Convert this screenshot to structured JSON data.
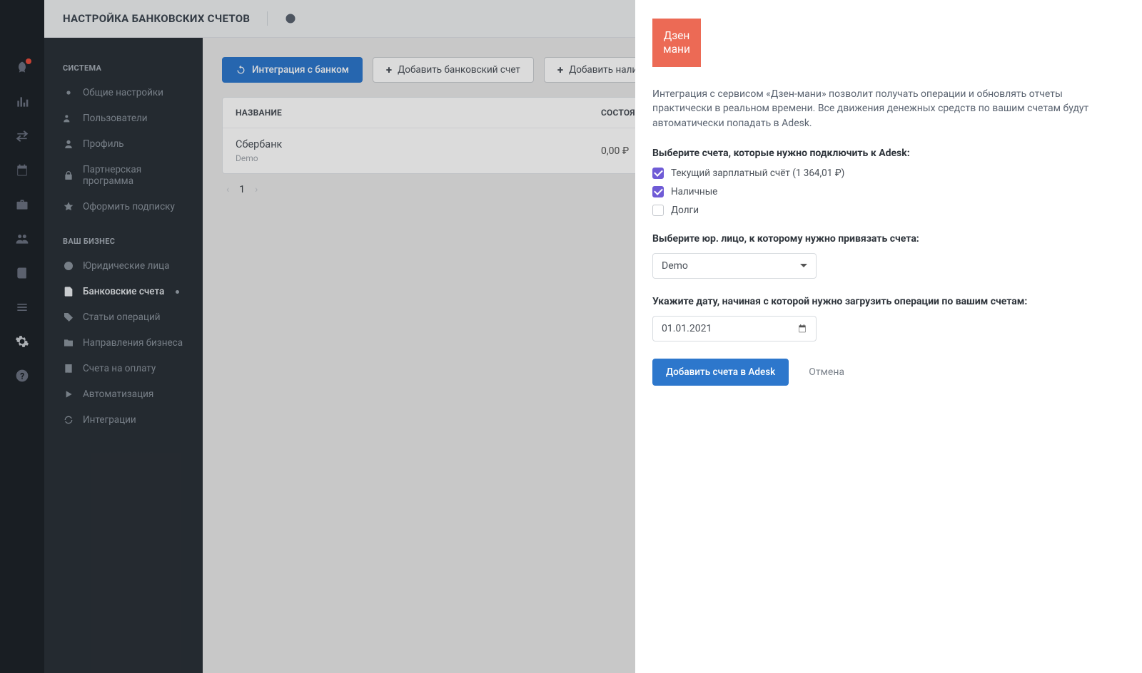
{
  "header": {
    "title": "НАСТРОЙКА БАНКОВСКИХ СЧЕТОВ"
  },
  "sidebar": {
    "group1_title": "СИСТЕМА",
    "group2_title": "ВАШ БИЗНЕС",
    "system": [
      {
        "label": "Общие настройки"
      },
      {
        "label": "Пользователи"
      },
      {
        "label": "Профиль"
      },
      {
        "label": "Партнерская программа"
      },
      {
        "label": "Оформить подписку"
      }
    ],
    "business": [
      {
        "label": "Юридические лица"
      },
      {
        "label": "Банковские счета"
      },
      {
        "label": "Статьи операций"
      },
      {
        "label": "Направления бизнеса"
      },
      {
        "label": "Счета на оплату"
      },
      {
        "label": "Автоматизация"
      },
      {
        "label": "Интеграции"
      }
    ]
  },
  "actions": {
    "integrate": "Интеграция с банком",
    "add_bank": "Добавить банковский счет",
    "add_cash": "Добавить наличные или кассу"
  },
  "table": {
    "col_name": "НАЗВАНИЕ",
    "col_state": "СОСТОЯНИЕ",
    "rows": [
      {
        "name": "Сбербанк",
        "sub": "Demo",
        "state": "0,00 ₽"
      }
    ]
  },
  "pager": {
    "prev": "‹",
    "current": "1",
    "next": "›"
  },
  "panel": {
    "logo_line1": "Дзен",
    "logo_line2": "мани",
    "description": "Интеграция с сервисом «Дзен-мани» позволит получать операции и обновлять отчеты практически в реальном времени. Все движения денежных средств по вашим счетам будут автоматически попадать в Adesk.",
    "select_accounts_label": "Выберите счета, которые нужно подключить к Adesk:",
    "accounts": [
      {
        "label": "Текущий зарплатный счёт (1 364,01 ₽)",
        "checked": true
      },
      {
        "label": "Наличные",
        "checked": true
      },
      {
        "label": "Долги",
        "checked": false
      }
    ],
    "entity_label": "Выберите юр. лицо, к которому нужно привязать счета:",
    "entity_value": "Demo",
    "date_label": "Укажите дату, начиная с которой нужно загрузить операции по вашим счетам:",
    "date_value": "01.01.2021",
    "submit": "Добавить счета в Adesk",
    "cancel": "Отмена"
  }
}
